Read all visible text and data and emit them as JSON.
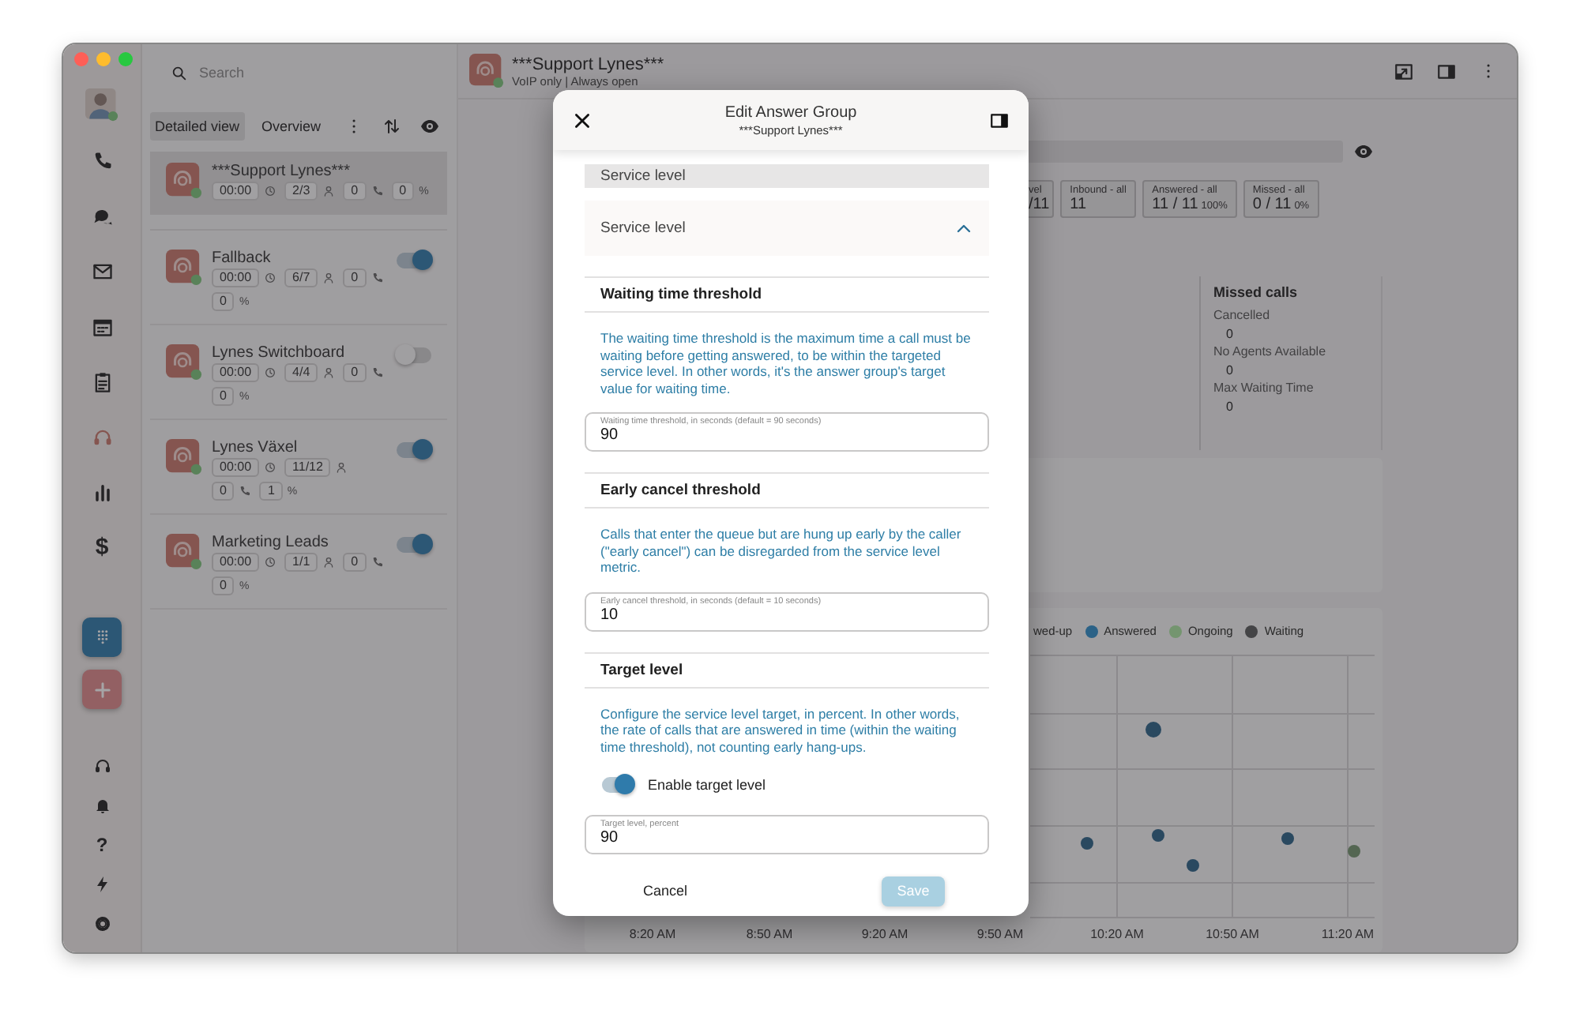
{
  "rail": {
    "items": [
      {
        "kind": "phone",
        "selected": false
      },
      {
        "kind": "chat",
        "selected": false
      },
      {
        "kind": "mail",
        "selected": false
      },
      {
        "kind": "calendar",
        "selected": false
      },
      {
        "kind": "clipboard",
        "selected": false
      },
      {
        "kind": "headset",
        "selected": true
      },
      {
        "kind": "bar-chart",
        "selected": false
      },
      {
        "kind": "dollar",
        "label": "$",
        "selected": false
      }
    ],
    "actions": [
      {
        "kind": "dialpad"
      },
      {
        "kind": "plus"
      }
    ],
    "bottom": [
      {
        "kind": "headset"
      },
      {
        "kind": "bell"
      },
      {
        "kind": "help",
        "label": "?"
      },
      {
        "kind": "bolt"
      },
      {
        "kind": "settings"
      }
    ]
  },
  "list": {
    "search": {
      "placeholder": "Search"
    },
    "tabs": [
      {
        "label": "Detailed view",
        "selected": true
      },
      {
        "label": "Overview",
        "selected": false
      }
    ],
    "current": {
      "name": "***Support Lynes***",
      "selected": true,
      "stats": [
        {
          "kind": "time",
          "value": "00:00"
        },
        {
          "kind": "agents",
          "value": "2/3"
        },
        {
          "kind": "calls",
          "value": "0"
        },
        {
          "kind": "percent",
          "value": "0",
          "unit": "%"
        }
      ]
    },
    "groups": [
      {
        "name": "Fallback",
        "selected": false,
        "on": true,
        "stats": [
          {
            "kind": "time",
            "value": "00:00"
          },
          {
            "kind": "agents",
            "value": "6/7"
          },
          {
            "kind": "calls",
            "value": "0"
          },
          {
            "kind": "percent",
            "value": "0",
            "unit": "%"
          }
        ]
      },
      {
        "name": "Lynes Switchboard",
        "selected": false,
        "on": false,
        "stats": [
          {
            "kind": "time",
            "value": "00:00"
          },
          {
            "kind": "agents",
            "value": "4/4"
          },
          {
            "kind": "calls",
            "value": "0"
          },
          {
            "kind": "percent",
            "value": "0",
            "unit": "%"
          }
        ]
      },
      {
        "name": "Lynes Växel",
        "selected": false,
        "on": true,
        "stats": [
          {
            "kind": "time",
            "value": "00:00"
          },
          {
            "kind": "agents",
            "value": "11/12"
          },
          {
            "kind": "calls",
            "value": "0"
          },
          {
            "kind": "percent",
            "value": "1",
            "unit": "%"
          }
        ]
      },
      {
        "name": "Marketing Leads",
        "selected": false,
        "on": true,
        "stats": [
          {
            "kind": "time",
            "value": "00:00"
          },
          {
            "kind": "agents",
            "value": "1/1"
          },
          {
            "kind": "calls",
            "value": "0"
          },
          {
            "kind": "percent",
            "value": "0",
            "unit": "%"
          }
        ]
      }
    ]
  },
  "header": {
    "title": "***Support Lynes***",
    "subtitle": "VoIP only | Always open"
  },
  "tiles": [
    {
      "label": "vel",
      "value": "/11"
    },
    {
      "label": "Inbound - all",
      "value": "11"
    },
    {
      "label": "Answered - all",
      "value": "11 / 11",
      "percent": "100%"
    },
    {
      "label": "Missed - all",
      "value": "0 / 11",
      "percent": "0%"
    }
  ],
  "missed": {
    "title": "Missed calls",
    "rows": [
      {
        "label": "Cancelled",
        "value": "0"
      },
      {
        "label": "No Agents Available",
        "value": "0"
      },
      {
        "label": "Max Waiting Time",
        "value": "0"
      }
    ]
  },
  "chart": {
    "legend": [
      {
        "label": "wed-up"
      },
      {
        "label": "Answered",
        "color": "#2b6287"
      },
      {
        "label": "Ongoing",
        "color": "#74956f"
      },
      {
        "label": "Waiting",
        "color": "#444446"
      }
    ],
    "x_labels": [
      "8:20 AM",
      "8:50 AM",
      "9:20 AM",
      "9:50 AM",
      "10:20 AM",
      "10:50 AM",
      "11:20 AM"
    ]
  },
  "modal": {
    "title": "Edit Answer Group",
    "subtitle": "***Support Lynes***",
    "section": "Service level",
    "expander": {
      "label": "Service level",
      "expanded": true
    },
    "blocks": [
      {
        "title": "Waiting time threshold",
        "description": "The waiting time threshold is the maximum time a call must be waiting before getting answered, to be within the targeted service level. In other words, it's the answer group's target value for waiting time.",
        "field": {
          "label": "Waiting time threshold, in seconds (default = 90 seconds)",
          "value": "90"
        }
      },
      {
        "title": "Early cancel threshold",
        "description": "Calls that enter the queue but are hung up early by the caller (\"early cancel\") can be disregarded from the service level metric.",
        "field": {
          "label": "Early cancel threshold, in seconds (default = 10 seconds)",
          "value": "10"
        }
      },
      {
        "title": "Target level",
        "description": "Configure the service level target, in percent. In other words, the rate of calls that are answered in time (within the waiting time threshold), not counting early hang-ups.",
        "toggle": {
          "label": "Enable target level",
          "on": true
        },
        "field": {
          "label": "Target level, percent",
          "value": "90"
        }
      }
    ],
    "cancel": "Cancel",
    "save": {
      "label": "Save",
      "disabled": true
    }
  }
}
